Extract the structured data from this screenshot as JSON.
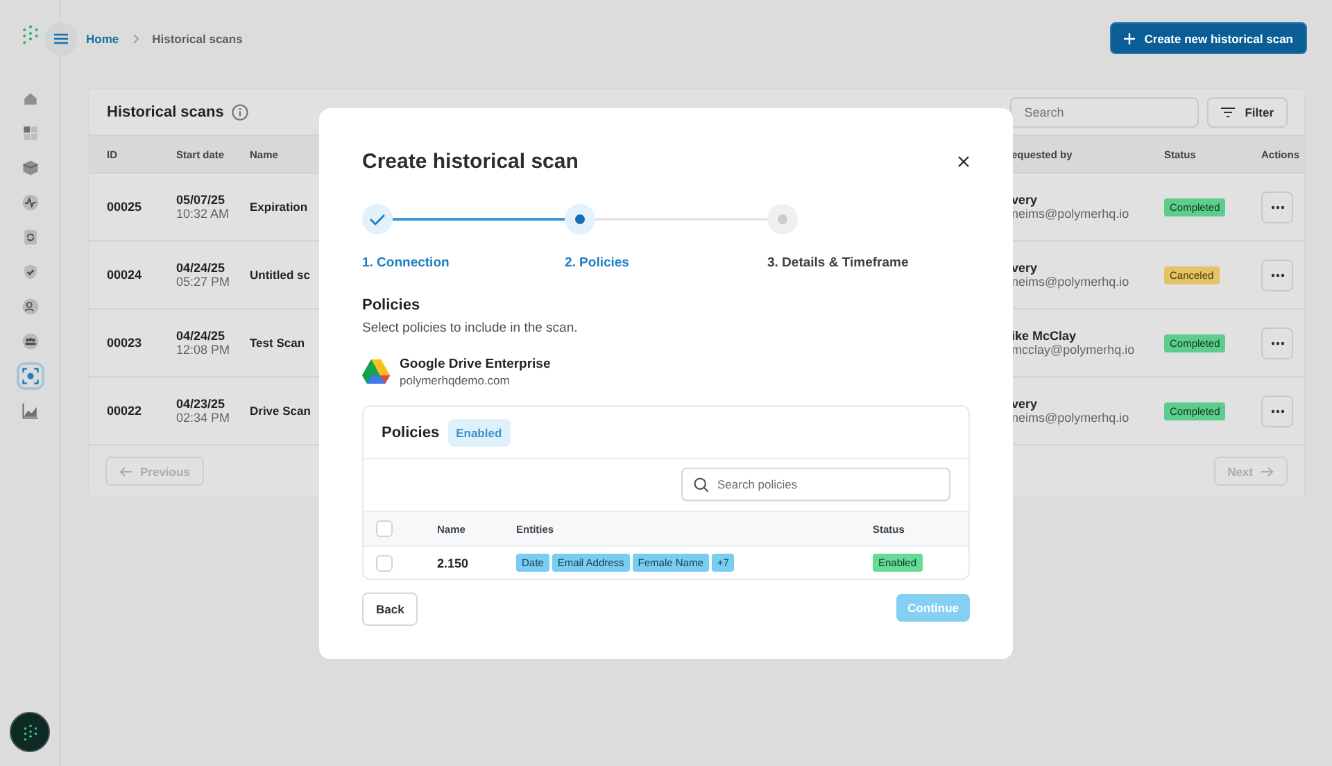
{
  "top_bar": {
    "breadcrumb": [
      {
        "label": "Home",
        "kind": "link"
      },
      {
        "label": "Historical scans",
        "kind": "current"
      }
    ],
    "create_button": "Create new historical scan"
  },
  "sidebar": {
    "items": [
      {
        "selected": false
      },
      {
        "selected": false
      },
      {
        "selected": false
      },
      {
        "selected": false
      },
      {
        "selected": false
      },
      {
        "selected": false
      },
      {
        "selected": false
      },
      {
        "selected": false
      },
      {
        "selected": true
      },
      {
        "selected": false
      }
    ]
  },
  "scans_card": {
    "title": "Historical scans",
    "search": {
      "placeholder": "Search"
    },
    "filter_button": "Filter",
    "columns": [
      "ID",
      "Start date",
      "Name",
      "equested by",
      "Status",
      "Actions"
    ],
    "rows": [
      {
        "id": "00025",
        "date": "05/07/25",
        "time": "10:32 AM",
        "name": "Expiration",
        "requester": "very",
        "email": "neims@polymerhq.io",
        "status": "Completed",
        "kind": "completed"
      },
      {
        "id": "00024",
        "date": "04/24/25",
        "time": "05:27 PM",
        "name": "Untitled sc",
        "requester": "very",
        "email": "neims@polymerhq.io",
        "status": "Canceled",
        "kind": "canceled"
      },
      {
        "id": "00023",
        "date": "04/24/25",
        "time": "12:08 PM",
        "name": "Test Scan",
        "requester": "ike McClay",
        "email": "mcclay@polymerhq.io",
        "status": "Completed",
        "kind": "completed"
      },
      {
        "id": "00022",
        "date": "04/23/25",
        "time": "02:34 PM",
        "name": "Drive Scan",
        "requester": "very",
        "email": "neims@polymerhq.io",
        "status": "Completed",
        "kind": "completed"
      }
    ],
    "previous_button": "Previous",
    "next_button": "Next"
  },
  "modal": {
    "title": "Create historical scan",
    "steps": [
      {
        "label": "1. Connection",
        "completed": true,
        "selected": false
      },
      {
        "label": "2. Policies",
        "completed": false,
        "selected": true
      },
      {
        "label": "3. Details & Timeframe",
        "completed": false,
        "selected": false
      }
    ],
    "section_title": "Policies",
    "section_subtitle": "Select policies to include in the scan.",
    "source": {
      "name": "Google Drive Enterprise",
      "domain": "polymerhqdemo.com"
    },
    "policies": {
      "title": "Policies",
      "badge": "Enabled",
      "search": {
        "placeholder": "Search policies"
      },
      "columns": [
        "Name",
        "Entities",
        "Status"
      ],
      "select_all_checked": false,
      "rows": [
        {
          "checked": false,
          "name": "2.150",
          "entities": [
            "Date",
            "Email Address",
            "Female Name",
            "+7"
          ],
          "status": "Enabled"
        }
      ]
    },
    "back_button": "Back",
    "continue_button": {
      "label": "Continue",
      "disabled": true
    }
  }
}
